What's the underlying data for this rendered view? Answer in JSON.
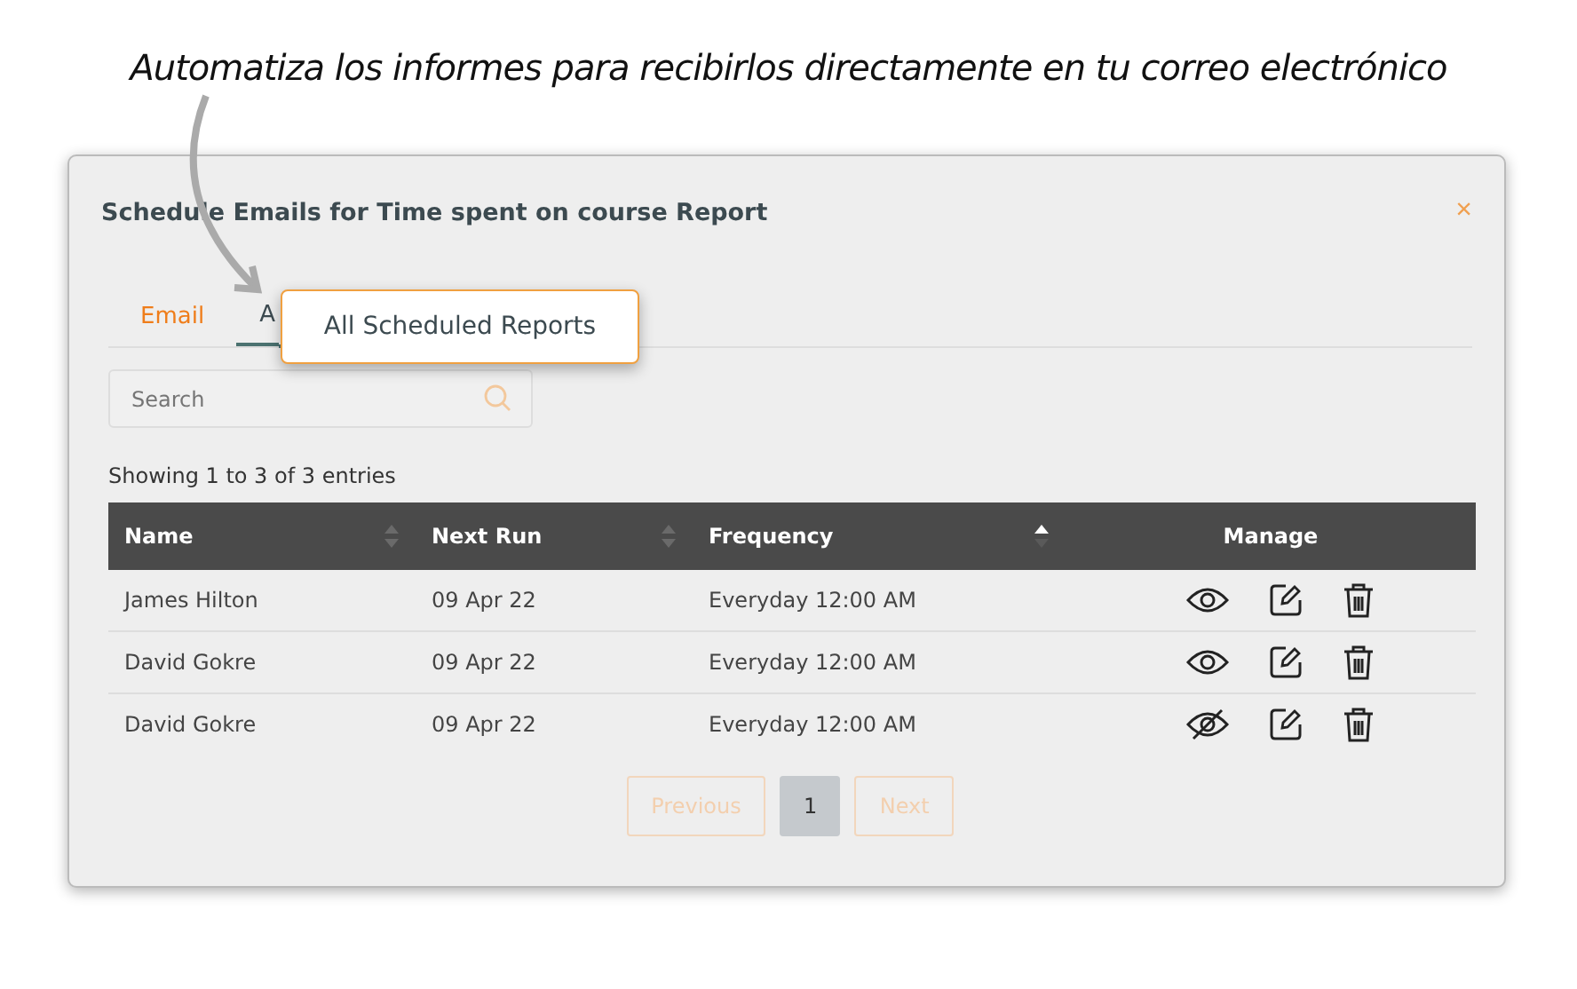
{
  "annotation": {
    "caption": "Automatiza los informes para recibirlos directamente en tu correo electrónico",
    "callout": "All Scheduled Reports"
  },
  "dialog": {
    "title": "Schedule Emails for Time spent on course Report",
    "close": "×",
    "tabs": [
      {
        "label": "Email",
        "selected": false
      },
      {
        "label": "A",
        "selected": true
      }
    ],
    "search": {
      "placeholder": "Search"
    },
    "info": "Showing 1 to 3 of 3 entries",
    "table": {
      "columns": [
        {
          "label": "Name",
          "sorted": false
        },
        {
          "label": "Next Run",
          "sorted": false
        },
        {
          "label": "Frequency",
          "sorted": true
        },
        {
          "label": "Manage"
        }
      ],
      "rows": [
        {
          "name": "James Hilton",
          "next_run": "09 Apr 22",
          "frequency": "Everyday 12:00 AM",
          "visible": true
        },
        {
          "name": "David Gokre",
          "next_run": "09 Apr 22",
          "frequency": "Everyday 12:00 AM",
          "visible": true
        },
        {
          "name": "David Gokre",
          "next_run": "09 Apr 22",
          "frequency": "Everyday 12:00 AM",
          "visible": false
        }
      ]
    },
    "pagination": {
      "previous": {
        "label": "Previous",
        "disabled": true
      },
      "pages": [
        {
          "label": "1",
          "selected": true
        }
      ],
      "next": {
        "label": "Next",
        "disabled": true
      }
    }
  }
}
